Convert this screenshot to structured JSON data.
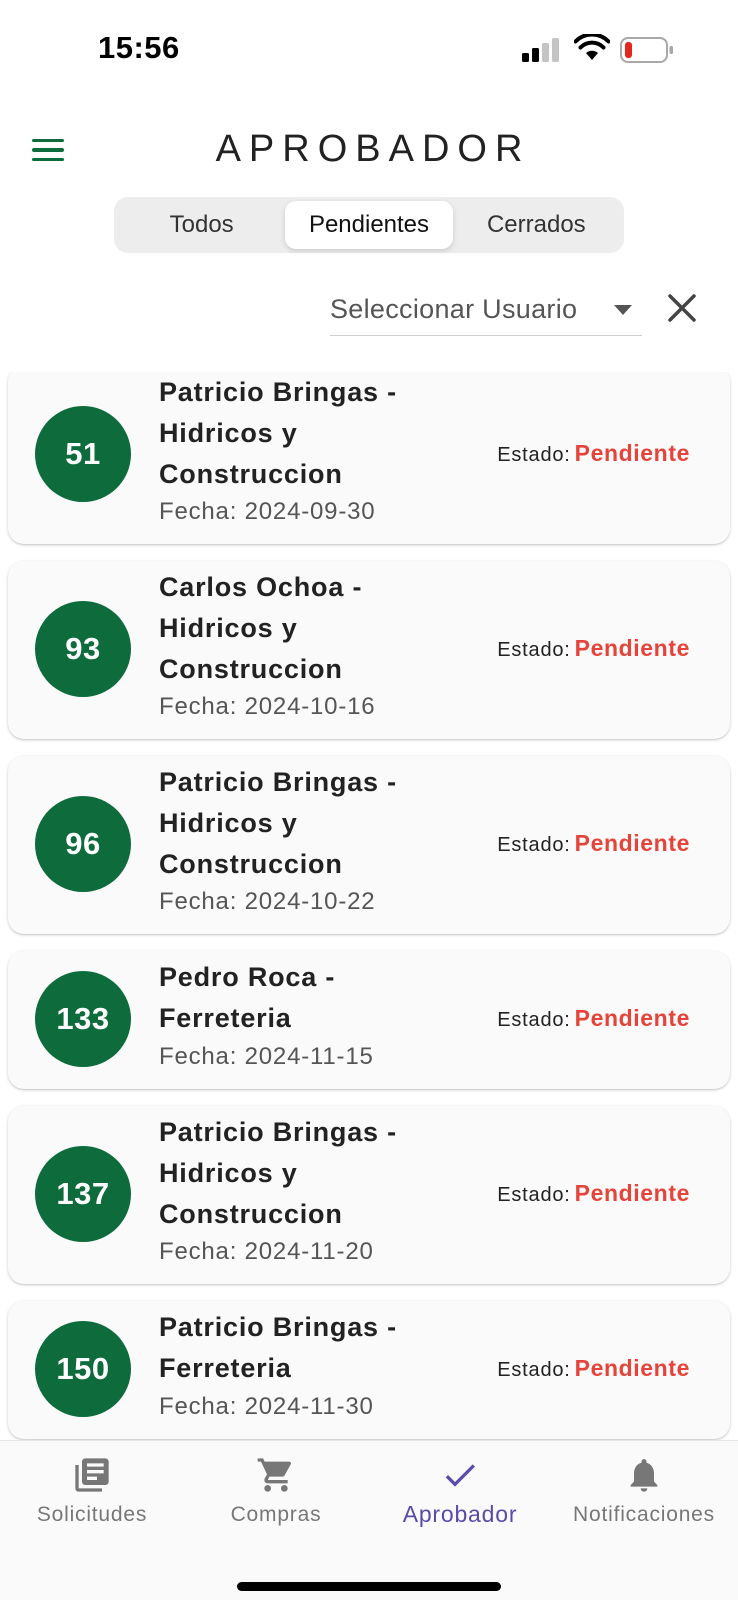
{
  "status_bar": {
    "time": "15:56",
    "icons": [
      "signal-icon",
      "wifi-icon",
      "battery-icon"
    ]
  },
  "header": {
    "title": "APROBADOR",
    "menu_icon": "menu-icon"
  },
  "tabs": [
    {
      "label": "Todos",
      "active": false
    },
    {
      "label": "Pendientes",
      "active": true
    },
    {
      "label": "Cerrados",
      "active": false
    }
  ],
  "filter": {
    "user_select_label": "Seleccionar Usuario",
    "clear_icon": "close-icon"
  },
  "requests": [
    {
      "id": "51",
      "title": "Patricio Bringas - Hidricos y Construccion",
      "date": "Fecha: 2024-09-30",
      "status_label": "Estado:",
      "status": "Pendiente"
    },
    {
      "id": "93",
      "title": "Carlos Ochoa - Hidricos y Construccion",
      "date": "Fecha: 2024-10-16",
      "status_label": "Estado:",
      "status": "Pendiente"
    },
    {
      "id": "96",
      "title": "Patricio Bringas - Hidricos y Construccion",
      "date": "Fecha: 2024-10-22",
      "status_label": "Estado:",
      "status": "Pendiente"
    },
    {
      "id": "133",
      "title": "Pedro Roca - Ferreteria",
      "date": "Fecha: 2024-11-15",
      "status_label": "Estado:",
      "status": "Pendiente"
    },
    {
      "id": "137",
      "title": "Patricio Bringas - Hidricos y Construccion",
      "date": "Fecha: 2024-11-20",
      "status_label": "Estado:",
      "status": "Pendiente"
    },
    {
      "id": "150",
      "title": "Patricio Bringas - Ferreteria",
      "date": "Fecha: 2024-11-30",
      "status_label": "Estado:",
      "status": "Pendiente"
    }
  ],
  "bottom_nav": [
    {
      "label": "Solicitudes",
      "icon": "library-books-icon",
      "active": false
    },
    {
      "label": "Compras",
      "icon": "shopping-cart-icon",
      "active": false
    },
    {
      "label": "Aprobador",
      "icon": "check-icon",
      "active": true
    },
    {
      "label": "Notificaciones",
      "icon": "bell-icon",
      "active": false
    }
  ],
  "colors": {
    "primary_green": "#0d6b3c",
    "pending_red": "#e5443a",
    "active_nav": "#5b4aa8"
  }
}
